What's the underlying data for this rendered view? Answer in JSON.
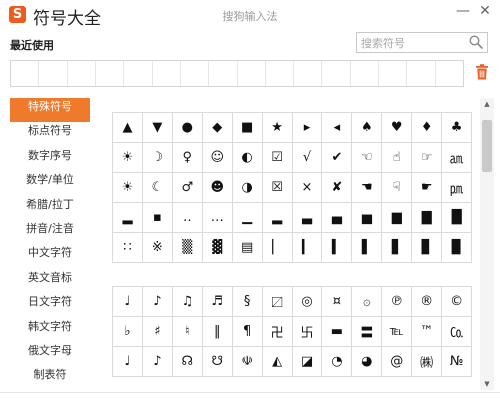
{
  "window": {
    "title": "符号大全",
    "ime_name": "搜狗输入法",
    "logo_letter": "S",
    "minimize_glyph": "—",
    "close_glyph": "✕",
    "accent_color": "#f07a2c"
  },
  "recent": {
    "title": "最近使用"
  },
  "search": {
    "placeholder": "搜索符号",
    "icon": "search-icon"
  },
  "sidebar": {
    "items": [
      {
        "label": "特殊符号",
        "active": true
      },
      {
        "label": "标点符号"
      },
      {
        "label": "数字序号"
      },
      {
        "label": "数学/单位"
      },
      {
        "label": "希腊/拉丁"
      },
      {
        "label": "拼音/注音"
      },
      {
        "label": "中文字符"
      },
      {
        "label": "英文音标"
      },
      {
        "label": "日文字符"
      },
      {
        "label": "韩文字符"
      },
      {
        "label": "俄文字母"
      },
      {
        "label": "制表符"
      }
    ]
  },
  "symbols": {
    "block1": [
      [
        "▲",
        "▼",
        "●",
        "◆",
        "■",
        "★",
        "▸",
        "◂",
        "♠",
        "♥",
        "♦",
        "♣"
      ],
      [
        "☀",
        "☽",
        "♀",
        "☺",
        "◐",
        "☑",
        "√",
        "✔",
        "☜",
        "☝",
        "☞",
        "㏂"
      ],
      [
        "☀",
        "☾",
        "♂",
        "☻",
        "◑",
        "☒",
        "×",
        "✘",
        "☚",
        "☟",
        "☛",
        "㏘"
      ],
      [
        "▂",
        "▪",
        "‥",
        "…",
        "▁",
        "▂",
        "▃",
        "▄",
        "▅",
        "▆",
        "▇",
        "█"
      ],
      [
        "∷",
        "※",
        "▒",
        "▓",
        "▤",
        "▏",
        "▎",
        "▍",
        "▌",
        "▋",
        "▊",
        "▉"
      ]
    ],
    "block2": [
      [
        "♩",
        "♪",
        "♫",
        "♬",
        "§",
        "〼",
        "◎",
        "¤",
        "۞",
        "℗",
        "®",
        "©"
      ],
      [
        "♭",
        "♯",
        "♮",
        "‖",
        "¶",
        "卍",
        "卐",
        "▬",
        "〓",
        "℡",
        "™",
        "㏇"
      ],
      [
        "♩",
        "♪",
        "☊",
        "☋",
        "☫",
        "◭",
        "◪",
        "◔",
        "◕",
        "@",
        "㈱",
        "№"
      ]
    ]
  }
}
